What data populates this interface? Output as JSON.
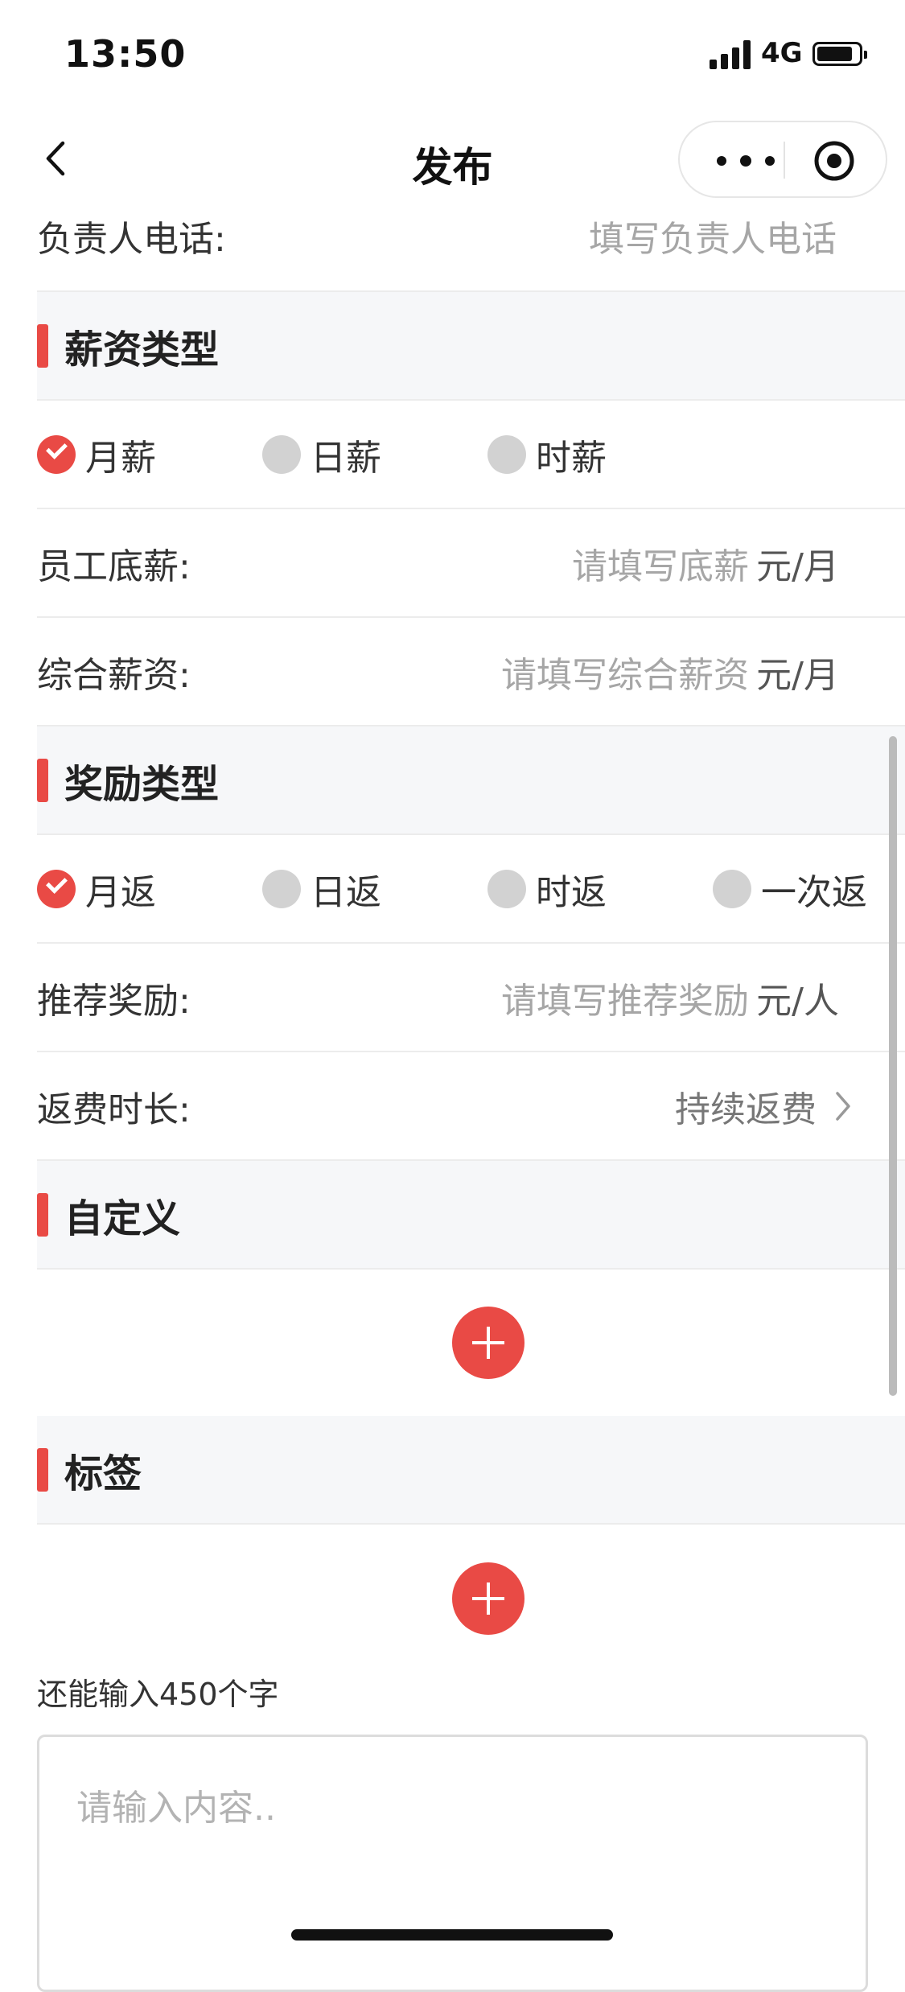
{
  "status_bar": {
    "time": "13:50",
    "network": "4G",
    "battery_level": 0.85
  },
  "nav": {
    "title": "发布",
    "back_icon": "chevron-left-icon",
    "more_icon": "more-dots-icon",
    "close_icon": "target-icon"
  },
  "contact": {
    "label": "负责人电话:",
    "placeholder": "填写负责人电话"
  },
  "salary": {
    "section_title": "薪资类型",
    "options": [
      {
        "label": "月薪",
        "checked": true
      },
      {
        "label": "日薪",
        "checked": false
      },
      {
        "label": "时薪",
        "checked": false
      }
    ],
    "base": {
      "label": "员工底薪:",
      "placeholder": "请填写底薪",
      "unit": "元/月"
    },
    "total": {
      "label": "综合薪资:",
      "placeholder": "请填写综合薪资",
      "unit": "元/月"
    }
  },
  "reward": {
    "section_title": "奖励类型",
    "options": [
      {
        "label": "月返",
        "checked": true
      },
      {
        "label": "日返",
        "checked": false
      },
      {
        "label": "时返",
        "checked": false
      },
      {
        "label": "一次返",
        "checked": false
      }
    ],
    "referral": {
      "label": "推荐奖励:",
      "placeholder": "请填写推荐奖励",
      "unit": "元/人"
    },
    "duration": {
      "label": "返费时长:",
      "value": "持续返费"
    }
  },
  "custom": {
    "section_title": "自定义"
  },
  "tags": {
    "section_title": "标签"
  },
  "content": {
    "remaining": "还能输入450个字",
    "placeholder": "请输入内容.."
  },
  "colors": {
    "accent": "#e94a45",
    "section_bg": "#f6f7f9",
    "placeholder": "#a6a6a6"
  }
}
